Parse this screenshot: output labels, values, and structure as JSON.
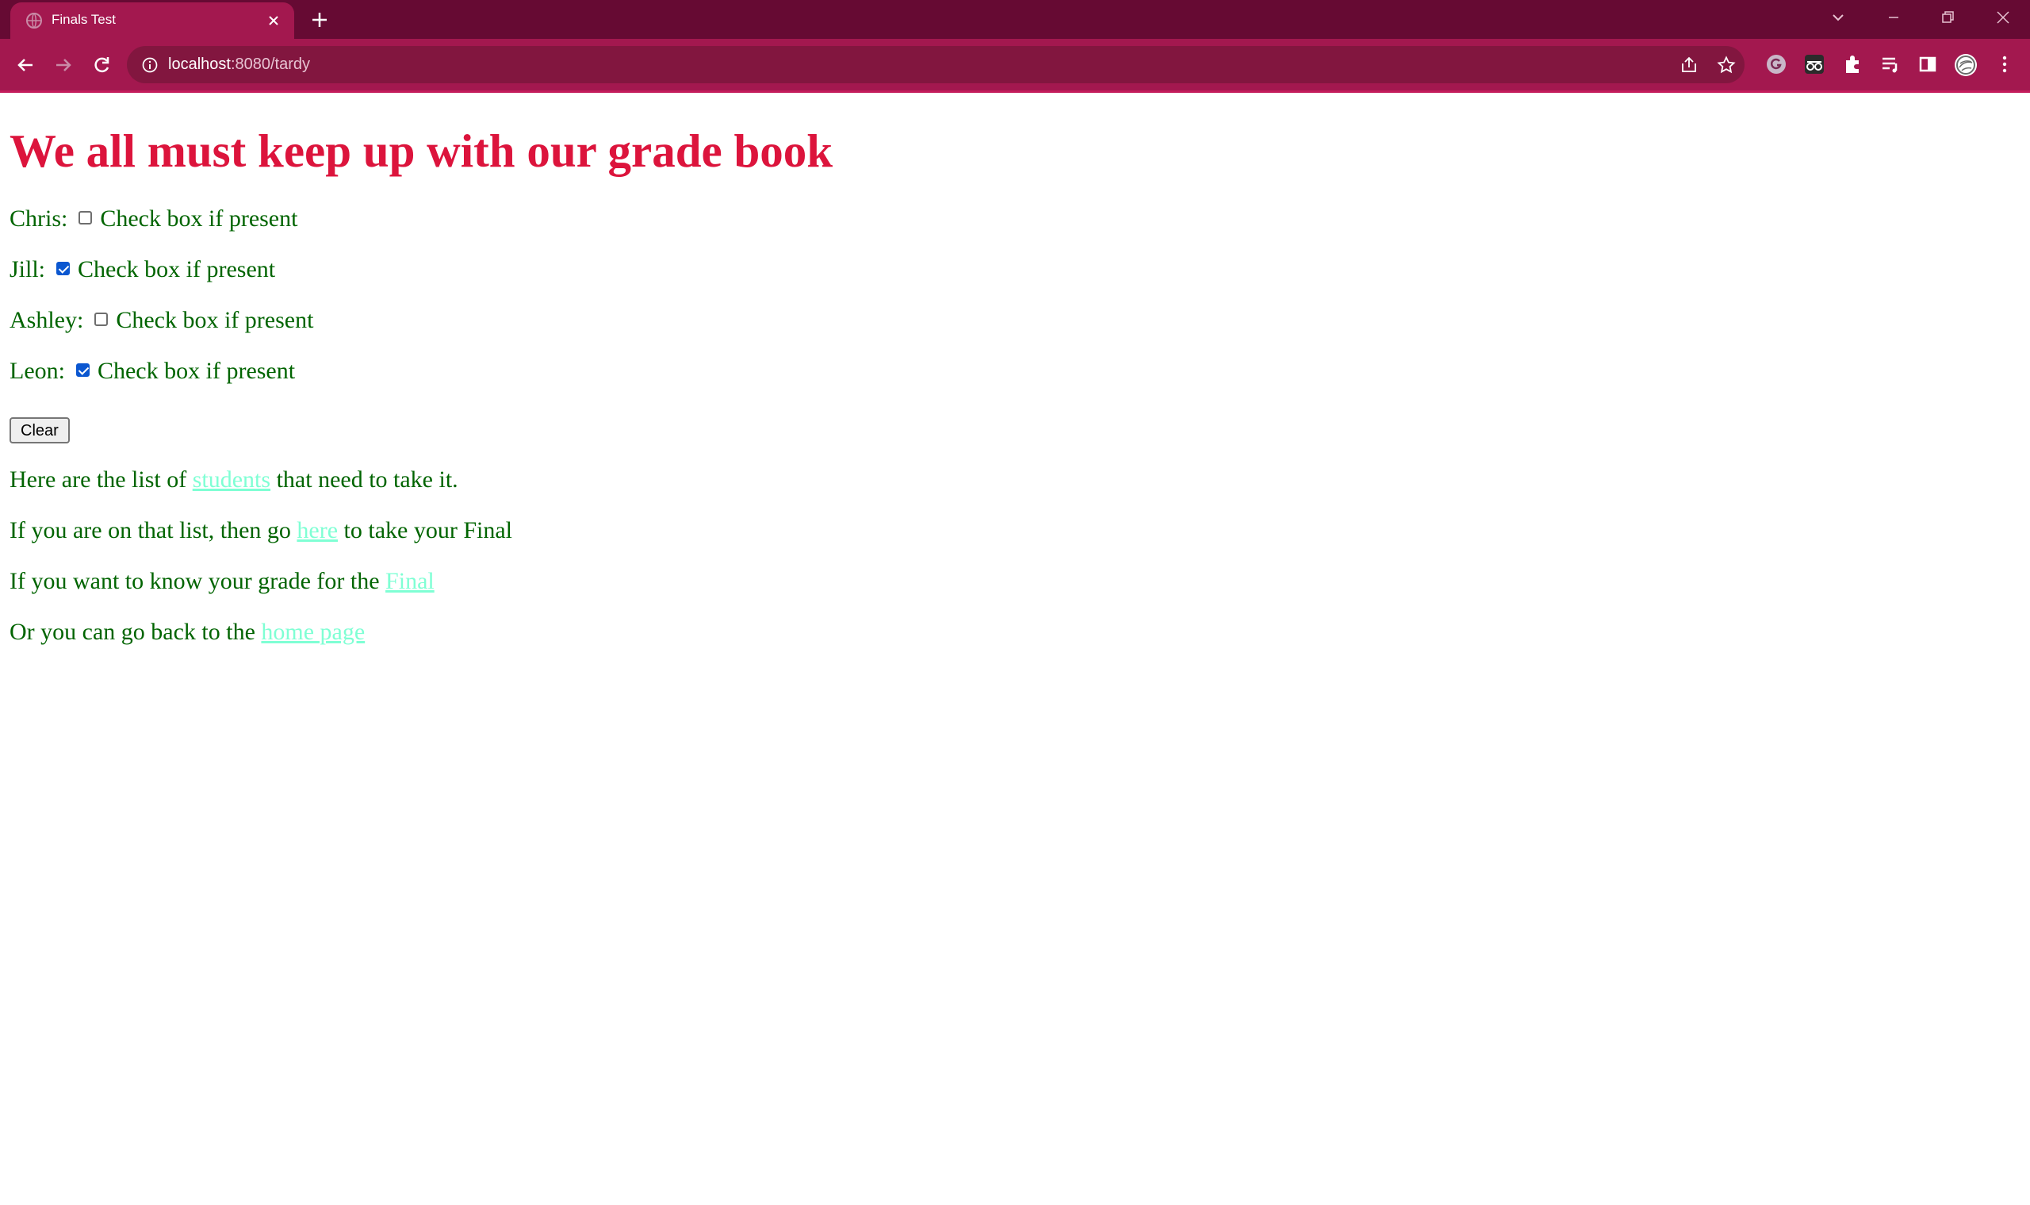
{
  "browser": {
    "tab_title": "Finals Test",
    "url_host": "localhost",
    "url_path": ":8080/tardy"
  },
  "page": {
    "heading": "We all must keep up with our grade book",
    "attendance": [
      {
        "name": "Chris:",
        "checkbox_label": "Check box if present",
        "checked": false
      },
      {
        "name": "Jill:",
        "checkbox_label": "Check box if present",
        "checked": true
      },
      {
        "name": "Ashley:",
        "checkbox_label": "Check box if present",
        "checked": false
      },
      {
        "name": "Leon:",
        "checkbox_label": "Check box if present",
        "checked": true
      }
    ],
    "clear_button": "Clear",
    "lines": [
      {
        "before": "Here are the list of ",
        "link": "students",
        "after": " that need to take it."
      },
      {
        "before": "If you are on that list, then go ",
        "link": "here",
        "after": " to take your Final"
      },
      {
        "before": "If you want to know your grade for the ",
        "link": "Final",
        "after": ""
      },
      {
        "before": "Or you can go back to the ",
        "link": "home page",
        "after": ""
      }
    ]
  },
  "colors": {
    "heading": "#dc143c",
    "text": "#006400",
    "link": "#7fffd4",
    "tabstrip": "#660a33",
    "toolbar": "#a3184f"
  }
}
